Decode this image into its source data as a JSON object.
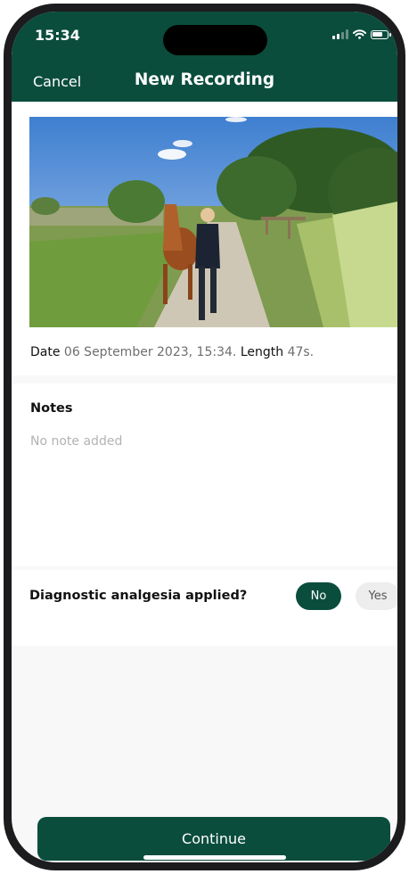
{
  "status_bar": {
    "time": "15:34"
  },
  "nav": {
    "cancel_label": "Cancel",
    "title": "New Recording"
  },
  "recording": {
    "date_label": "Date",
    "date_value": "06 September 2023, 15:34.",
    "length_label": "Length",
    "length_value": "47s."
  },
  "notes": {
    "title": "Notes",
    "placeholder": "No note added"
  },
  "diagnostic": {
    "question": "Diagnostic analgesia applied?",
    "options": [
      "No",
      "Yes"
    ],
    "selected": "No"
  },
  "footer": {
    "continue_label": "Continue"
  },
  "colors": {
    "brand": "#0b4d3d",
    "muted_text": "#6e6e6e",
    "placeholder": "#b3b3b3"
  },
  "icons": [
    "signal-icon",
    "wifi-icon",
    "battery-icon"
  ]
}
